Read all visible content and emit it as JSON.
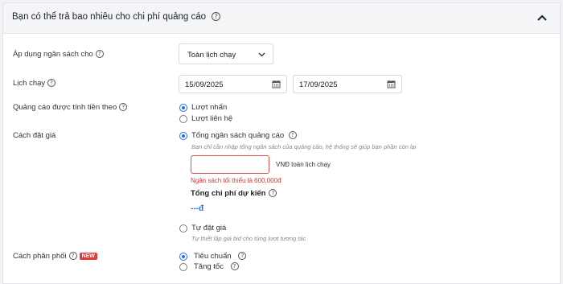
{
  "header": {
    "title": "Bạn có thể trả bao nhiêu cho chi phí quảng cáo",
    "help_glyph": "?"
  },
  "budget_apply": {
    "label": "Áp dụng ngân sách cho",
    "selected": "Toàn lịch chạy"
  },
  "schedule": {
    "label": "Lịch chạy",
    "start_date": "15/09/2025",
    "end_date": "17/09/2025"
  },
  "billing": {
    "label": "Quảng cáo được tính tiền theo",
    "options": [
      "Lượt nhấn",
      "Lượt liên hệ"
    ],
    "selected_index": 0
  },
  "bidding": {
    "label": "Cách đặt giá",
    "total_budget_option": "Tổng ngân sách quảng cáo",
    "total_budget_hint": "Bạn chỉ cần nhập tổng ngân sách của quảng cáo, hệ thống sẽ giúp bạn phần còn lại",
    "amount_value": "",
    "unit_label": "VNĐ toàn lịch chạy",
    "error": "Ngân sách tối thiểu là 600,000đ",
    "estimated_total_label": "Tổng chi phí dự kiến",
    "estimated_total_value": "---đ",
    "manual_option": "Tự đặt giá",
    "manual_hint": "Tự thiết lập giá bid cho từng lượt tương tác"
  },
  "distribution": {
    "label": "Cách phân phối",
    "badge": "NEW",
    "options": [
      "Tiêu chuẩn",
      "Tăng tốc"
    ],
    "selected_index": 0
  },
  "colors": {
    "accent": "#1a73e8",
    "error": "#d33",
    "badge": "#e53935"
  }
}
